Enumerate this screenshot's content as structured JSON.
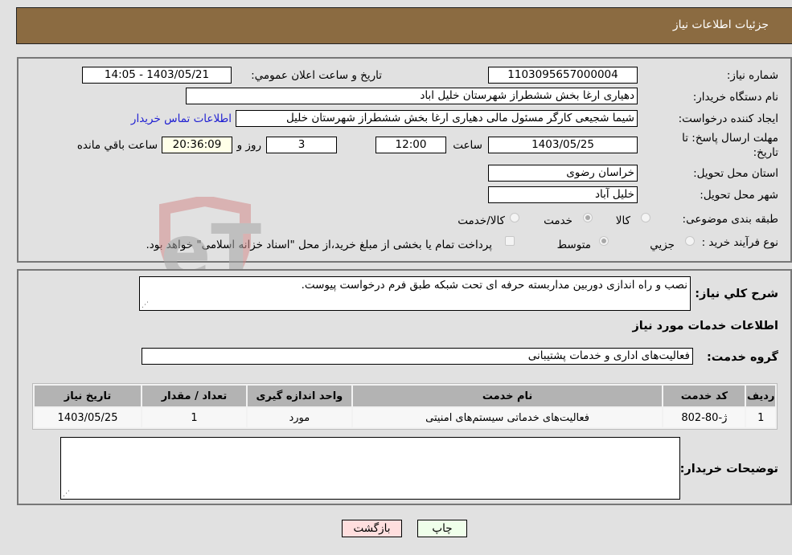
{
  "header": {
    "title": "جزئيات اطلاعات نياز"
  },
  "fields": {
    "need_number": {
      "label": "شماره نياز:",
      "value": "1103095657000004"
    },
    "announce_datetime": {
      "label": "تاريخ و ساعت اعلان عمومي:",
      "value": "1403/05/21 - 14:05"
    },
    "buyer_org": {
      "label": "نام دستگاه خريدار:",
      "value": "دهیاری ارغا بخش ششطراز شهرستان خلیل اباد"
    },
    "requester": {
      "label": "ايجاد کننده درخواست:",
      "value": "شیما شجیعی کارگر مسئول مالی دهیاری ارغا بخش ششطراز شهرستان خلیل"
    },
    "contact_link": "اطلاعات تماس خريدار",
    "deadline": {
      "label_line1": "مهلت ارسال پاسخ: تا",
      "label_line2": "تاريخ:",
      "date": "1403/05/25",
      "time_label": "ساعت",
      "time": "12:00",
      "days": "3",
      "days_label": "روز و",
      "remaining": "20:36:09",
      "remaining_label": "ساعت باقي مانده"
    },
    "province": {
      "label": "استان محل تحويل:",
      "value": "خراسان رضوی"
    },
    "city": {
      "label": "شهر محل تحويل:",
      "value": "خلیل آباد"
    },
    "category": {
      "label": "طبقه بندی موضوعی:",
      "options": [
        "کالا",
        "خدمت",
        "کالا/خدمت"
      ],
      "selected": "خدمت"
    },
    "purchase_type": {
      "label": "نوع فرآيند خريد :",
      "options": [
        "جزيي",
        "متوسط"
      ],
      "selected": "متوسط",
      "treasury_note": "پرداخت تمام يا بخشی از مبلغ خريد،از محل \"اسناد خزانه اسلامی\" خواهد بود."
    }
  },
  "description": {
    "label": "شرح کلي نياز:",
    "value": "نصب و راه اندازی دوربین مداربسته حرفه ای تحت شبکه طبق فرم درخواست پیوست."
  },
  "services_section": {
    "title": "اطلاعات خدمات مورد نياز",
    "group_label": "گروه خدمت:",
    "group_value": "فعالیت‌های اداری و خدمات پشتیبانی"
  },
  "table": {
    "headers": [
      "رديف",
      "کد خدمت",
      "نام خدمت",
      "واحد اندازه گيری",
      "تعداد / مقدار",
      "تاريخ نياز"
    ],
    "rows": [
      [
        "1",
        "ژ-80-802",
        "فعالیت‌های خدماتی سیستم‌های امنیتی",
        "مورد",
        "1",
        "1403/05/25"
      ]
    ]
  },
  "buyer_notes": {
    "label": "توضيحات خريدار:",
    "value": ""
  },
  "buttons": {
    "print": "چاپ",
    "back": "بازگشت"
  },
  "watermark": {
    "text": "AriaTender.neT"
  },
  "colors": {
    "header_bg": "#8b6b41",
    "link": "#1e1ed2",
    "print_bg": "#efffea",
    "back_bg": "#ffdede",
    "remaining_bg": "#ffffe8"
  }
}
